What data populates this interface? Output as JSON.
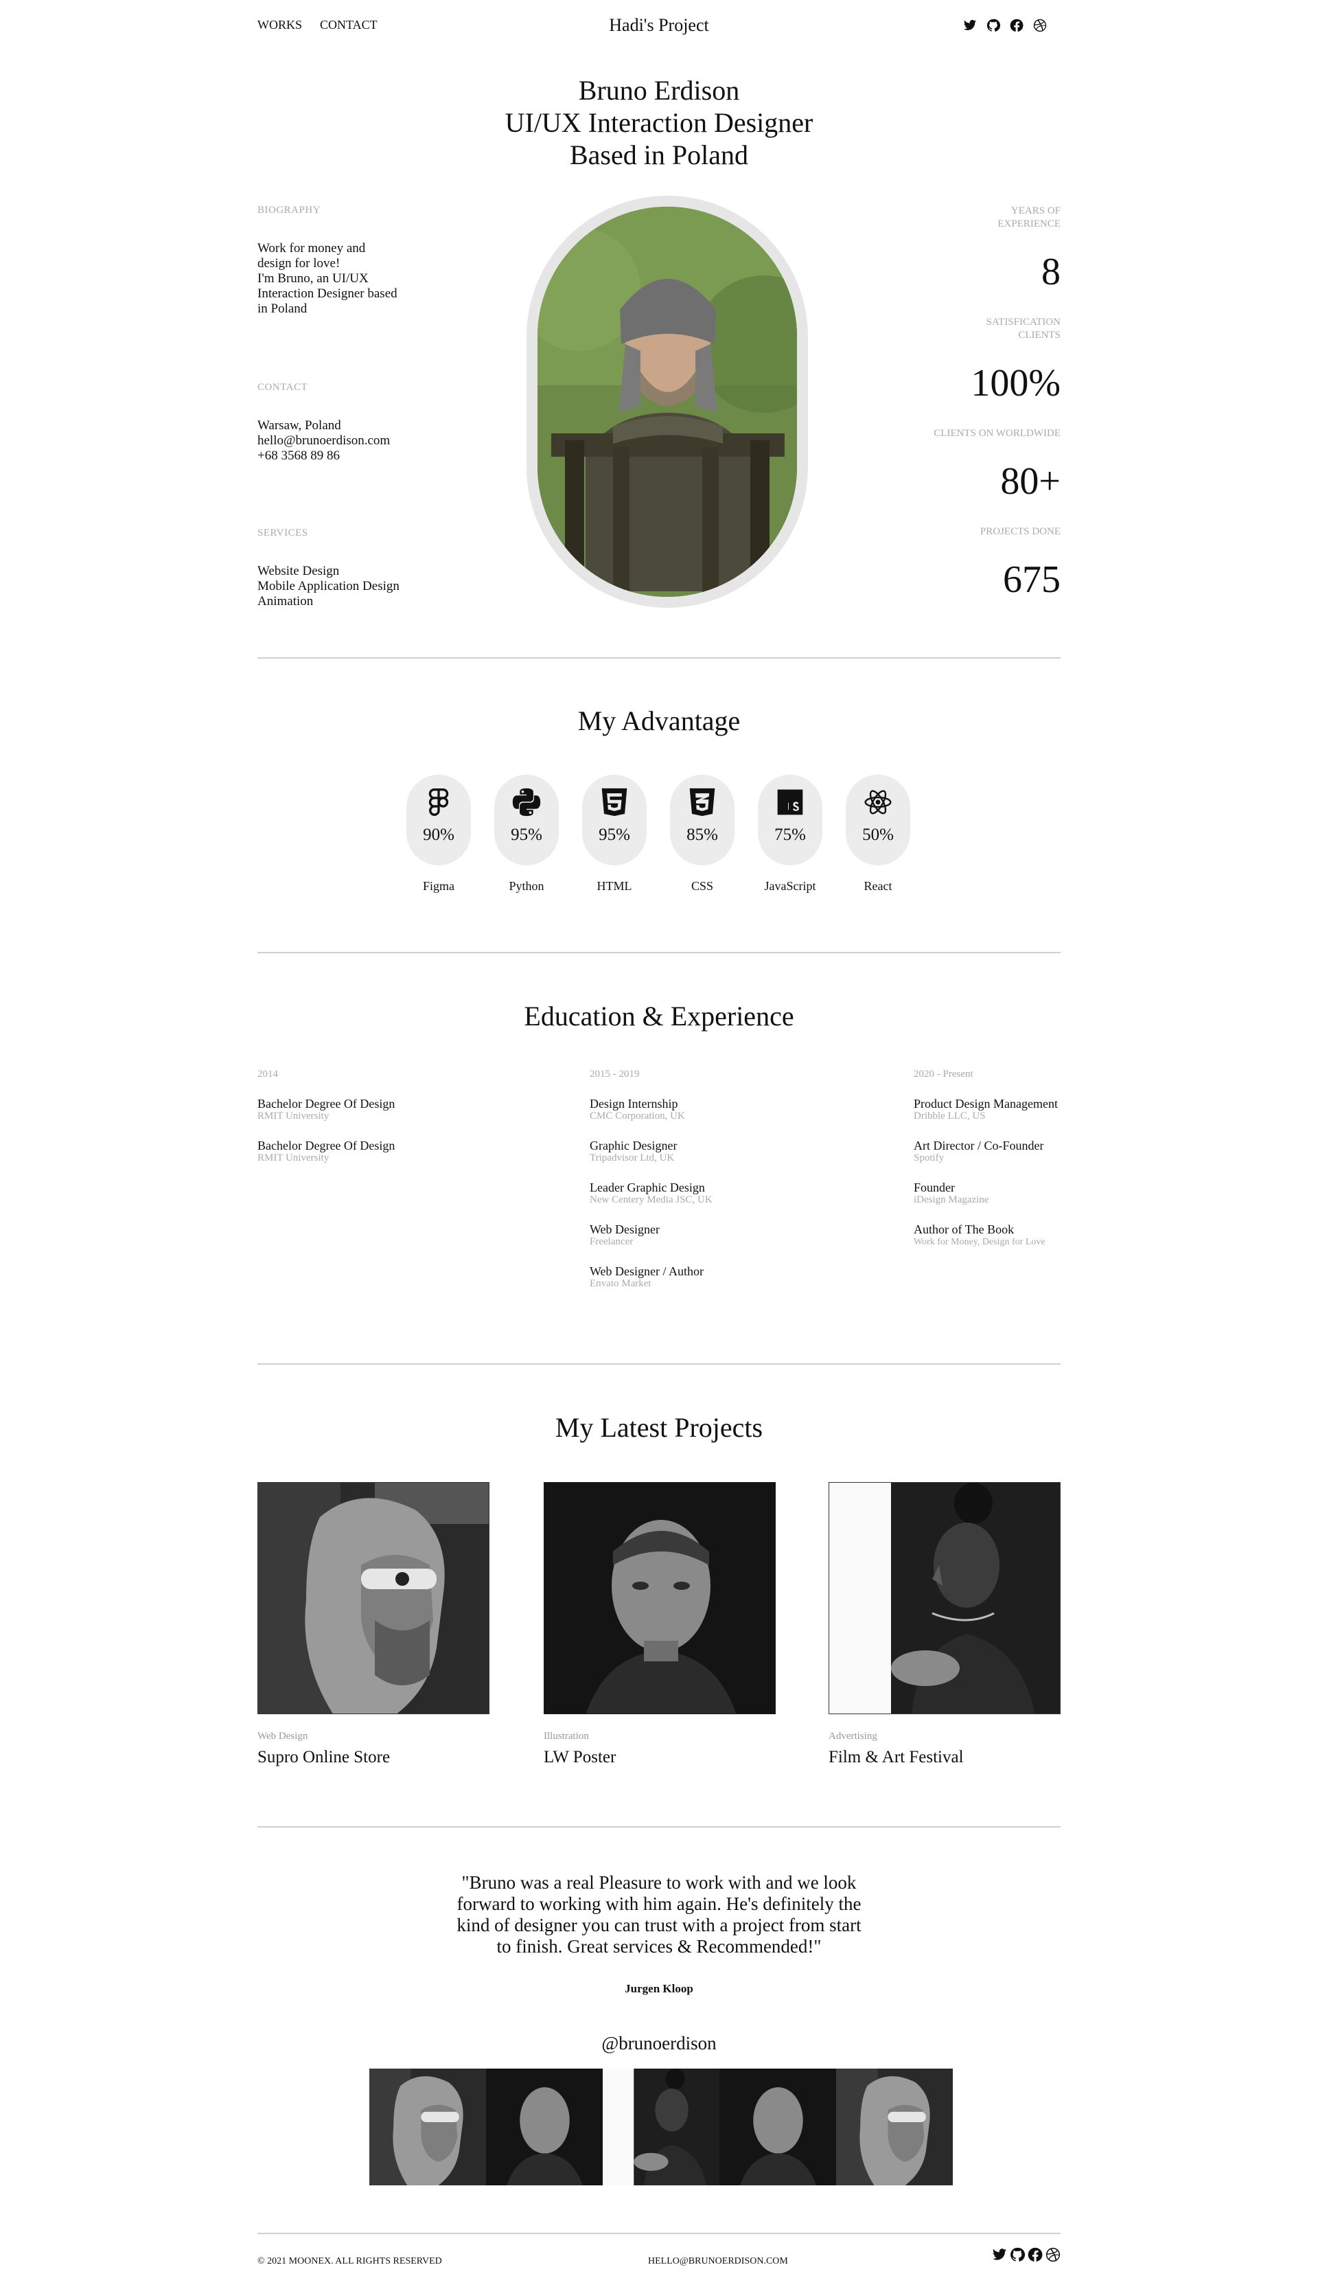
{
  "nav": {
    "works": "WORKS",
    "contact": "CONTACT",
    "brand": "Hadi's Project",
    "social": [
      "twitter-icon",
      "github-icon",
      "facebook-icon",
      "dribbble-icon"
    ]
  },
  "hero": {
    "line1": "Bruno Erdison",
    "line2": "UI/UX Interaction Designer",
    "line3": "Based in Poland"
  },
  "biography": {
    "label": "BIOGRAPHY",
    "lines": [
      "Work for money and",
      "design for love!",
      "I'm Bruno, an UI/UX",
      "Interaction Designer based",
      "in Poland"
    ]
  },
  "contact": {
    "label": "CONTACT",
    "lines": [
      "Warsaw, Poland",
      "hello@brunoerdison.com",
      "+68 3568 89 86"
    ]
  },
  "services": {
    "label": "SERVICES",
    "lines": [
      "Website Design",
      "Mobile Application Design",
      "Animation"
    ]
  },
  "stats": [
    {
      "label1": "YEARS OF",
      "label2": "EXPERIENCE",
      "value": "8"
    },
    {
      "label1": "SATISFICATION",
      "label2": "CLIENTS",
      "value": "100%"
    },
    {
      "label1": "CLIENTS ON WORLDWIDE",
      "label2": "",
      "value": "80+"
    },
    {
      "label1": "PROJECTS DONE",
      "label2": "",
      "value": "675"
    }
  ],
  "advantage": {
    "title": "My Advantage",
    "skills": [
      {
        "name": "Figma",
        "pct": "90%",
        "icon": "figma-icon"
      },
      {
        "name": "Python",
        "pct": "95%",
        "icon": "python-icon"
      },
      {
        "name": "HTML",
        "pct": "95%",
        "icon": "html5-icon"
      },
      {
        "name": "CSS",
        "pct": "85%",
        "icon": "css3-icon"
      },
      {
        "name": "JavaScript",
        "pct": "75%",
        "icon": "javascript-icon"
      },
      {
        "name": "React",
        "pct": "50%",
        "icon": "react-icon"
      }
    ]
  },
  "education": {
    "title": "Education & Experience",
    "columns": [
      {
        "year": "2014",
        "items": [
          {
            "title": "Bachelor Degree Of Design",
            "sub": "RMIT University"
          },
          {
            "title": "Bachelor Degree Of Design",
            "sub": "RMIT University"
          }
        ]
      },
      {
        "year": "2015 - 2019",
        "items": [
          {
            "title": "Design Internship",
            "sub": "CMC Corporation, UK"
          },
          {
            "title": "Graphic Designer",
            "sub": "Tripadvisor Ltd, UK"
          },
          {
            "title": "Leader Graphic Design",
            "sub": "New Centery Media JSC, UK"
          },
          {
            "title": "Web Designer",
            "sub": "Freelancer"
          },
          {
            "title": "Web Designer / Author",
            "sub": "Envato Market"
          }
        ]
      },
      {
        "year": "2020 - Present",
        "items": [
          {
            "title": "Product Design Management",
            "sub": "Dribble LLC, US"
          },
          {
            "title": "Art Director / Co-Founder",
            "sub": "Spotify"
          },
          {
            "title": "Founder",
            "sub": "iDesign Magazine"
          },
          {
            "title": "Author of The Book",
            "sub": "Work for Money, Design for Love"
          }
        ]
      }
    ]
  },
  "projects": {
    "title": "My Latest Projects",
    "items": [
      {
        "category": "Web Design",
        "name": "Supro Online Store"
      },
      {
        "category": "Illustration",
        "name": "LW Poster"
      },
      {
        "category": "Advertising",
        "name": "Film & Art Festival"
      }
    ]
  },
  "testimonial": {
    "quote": "\"Bruno was a real Pleasure to work with and we look forward to working with him again. He's definitely the kind of designer you can trust with a project from start to finish. Great services & Recommended!\"",
    "author": "Jurgen Kloop"
  },
  "instagram": {
    "handle": "@brunoerdison"
  },
  "footer": {
    "copyright": "© 2021 MOONEX. ALL RIGHTS RESERVED",
    "email": "HELLO@BRUNOERDISON.COM"
  }
}
